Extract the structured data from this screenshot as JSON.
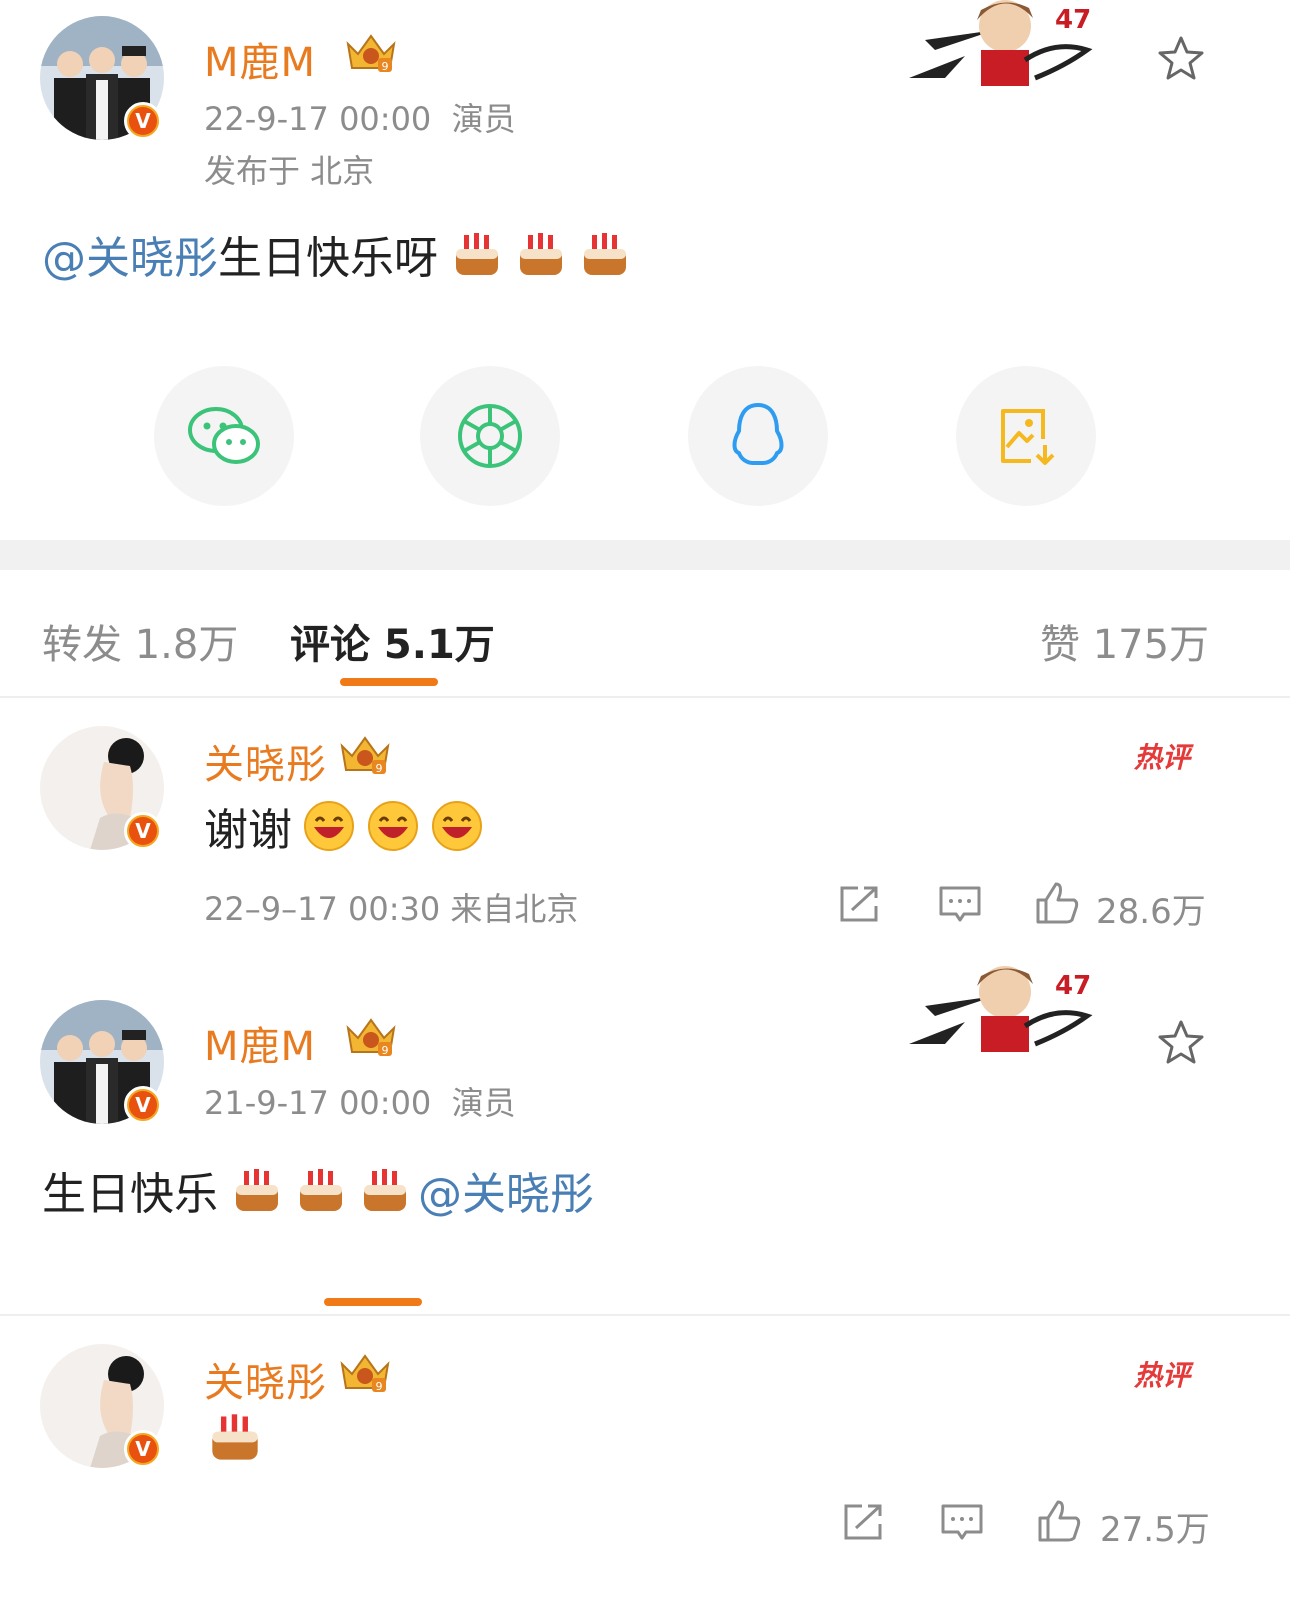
{
  "post": {
    "author": "M鹿M",
    "time": "22-9-17 00:00",
    "role": "演员",
    "location": "发布于 北京",
    "mention": "@关晓彤",
    "text": " 生日快乐呀",
    "emoji": "cake"
  },
  "share": [
    "wechat-icon",
    "moments-icon",
    "qq-icon",
    "save-image-icon"
  ],
  "tabs": {
    "repost": "转发 1.8万",
    "comment": "评论 5.1万",
    "like": "赞 175万"
  },
  "comments": [
    {
      "author": "关晓彤",
      "hot_label": "热评",
      "text": "谢谢",
      "emoji": "laugh",
      "time": "22–9–17 00:30 来自北京",
      "likes": "28.6万"
    }
  ],
  "post2": {
    "author": "M鹿M",
    "time": "21-9-17 00:00",
    "role": "演员",
    "text": "生日快乐 ",
    "mention": "@关晓彤"
  },
  "comment2": {
    "author": "关晓彤",
    "hot_label": "热评",
    "likes": "27.5万"
  },
  "colors": {
    "username": "#e87a1f",
    "mention": "#4a7fb5",
    "accent_bar": "#f07a17",
    "hot": "#e43a3a"
  }
}
